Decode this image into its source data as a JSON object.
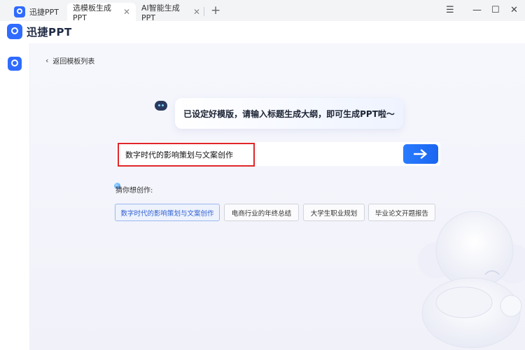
{
  "tabs": [
    {
      "label": "迅捷PPT"
    },
    {
      "label": "选模板生成PPT",
      "close": "✕"
    },
    {
      "label": "AI智能生成PPT",
      "close": "✕"
    }
  ],
  "tab_add": "+",
  "window_controls": {
    "menu": "☰",
    "minimize": "—",
    "maximize": "☐",
    "close": "✕"
  },
  "app": {
    "name": "迅捷PPT"
  },
  "main": {
    "back_label": "返回模板列表",
    "prompt_message": "已设定好模版，请输入标题生成大纲，即可生成PPT啦～",
    "input_value": "数字时代的影响策划与文案创作",
    "suggest_title": "猜你想创作:",
    "suggestions": [
      "数字时代的影响策划与文案创作",
      "电商行业的年终总结",
      "大学生职业规划",
      "毕业论文开题报告"
    ]
  },
  "colors": {
    "accent": "#2a7bff",
    "highlight_border": "#e0262b"
  }
}
